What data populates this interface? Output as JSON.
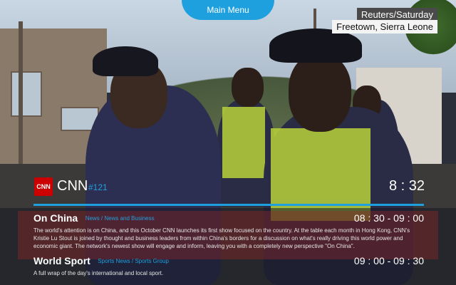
{
  "header": {
    "menu_label": "Main Menu"
  },
  "source_tag": {
    "line1": "Reuters/Saturday",
    "line2": "Freetown, Sierra Leone"
  },
  "channel": {
    "name": "CNN",
    "logo_text": "CNN",
    "number": "#121",
    "time": "8 : 32"
  },
  "programs": [
    {
      "title": "On China",
      "genre1": "News",
      "genre2": "News and Business",
      "time": "08 : 30 - 09 : 00",
      "description": "The world's attention is on China, and this October CNN launches its first show focused on the country. At the table each month in Hong Kong, CNN's Kristie Lu Stout is joined by thought and business leaders from within China's borders for a discussion on what's really driving this world power and economic giant. The network's newest show will engage and inform, leaving you with a completely new perspective \"On China\"."
    },
    {
      "title": "World Sport",
      "genre1": "Sports News",
      "genre2": "Sports Group",
      "time": "09 : 00 - 09 : 30",
      "description": "A full wrap of the day's international and local sport."
    }
  ],
  "colors": {
    "accent": "#1fa0de",
    "cnn_red": "#cc0000"
  }
}
